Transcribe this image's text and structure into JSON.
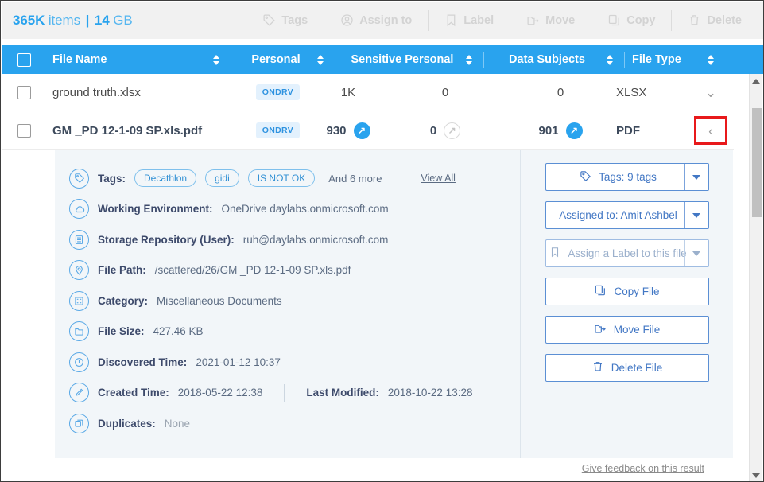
{
  "header": {
    "count": "365K",
    "count_unit": "items",
    "divider": "|",
    "size": "14",
    "size_unit": "GB",
    "toolbar": [
      {
        "label": "Tags",
        "icon": "tag-icon",
        "enabled": false
      },
      {
        "label": "Assign to",
        "icon": "user-circle-icon",
        "enabled": false
      },
      {
        "label": "Label",
        "icon": "bookmark-icon",
        "enabled": false
      },
      {
        "label": "Move",
        "icon": "move-folder-icon",
        "enabled": false
      },
      {
        "label": "Copy",
        "icon": "copy-icon",
        "enabled": false
      },
      {
        "label": "Delete",
        "icon": "trash-icon",
        "enabled": false
      }
    ]
  },
  "table": {
    "columns": {
      "file_name": "File Name",
      "personal": "Personal",
      "sensitive_personal": "Sensitive Personal",
      "data_subjects": "Data Subjects",
      "file_type": "File Type"
    },
    "rows": [
      {
        "file_name": "ground truth.xlsx",
        "badge": "ONDRV",
        "personal": "1K",
        "personal_link": false,
        "sensitive_personal": "0",
        "sensitive_link": false,
        "data_subjects": "0",
        "subjects_link": false,
        "file_type": "XLSX",
        "expanded": false,
        "chevron": "⌄"
      },
      {
        "file_name": "GM _PD 12-1-09 SP.xls.pdf",
        "badge": "ONDRV",
        "personal": "930",
        "personal_link": true,
        "sensitive_personal": "0",
        "sensitive_link": false,
        "data_subjects": "901",
        "subjects_link": true,
        "file_type": "PDF",
        "expanded": true,
        "chevron": "‹"
      }
    ]
  },
  "detail": {
    "tags": {
      "label": "Tags:",
      "icon": "tag-circle-icon",
      "pills": [
        "Decathlon",
        "gidi",
        "IS NOT OK"
      ],
      "more": "And 6 more",
      "view_all": "View All"
    },
    "fields": [
      {
        "icon": "cloud-icon",
        "label": "Working Environment:",
        "value": "OneDrive daylabs.onmicrosoft.com"
      },
      {
        "icon": "database-icon",
        "label": "Storage Repository (User):",
        "value": "ruh@daylabs.onmicrosoft.com"
      },
      {
        "icon": "location-pin-icon",
        "label": "File Path:",
        "value": "/scattered/26/GM _PD 12-1-09 SP.xls.pdf"
      },
      {
        "icon": "list-icon",
        "label": "Category:",
        "value": "Miscellaneous Documents"
      },
      {
        "icon": "folder-icon",
        "label": "File Size:",
        "value": "427.46 KB"
      },
      {
        "icon": "clock-icon",
        "label": "Discovered Time:",
        "value": "2021-01-12 10:37"
      }
    ],
    "created": {
      "icon": "pencil-icon",
      "label": "Created Time:",
      "value": "2018-05-22 12:38",
      "modified_label": "Last Modified:",
      "modified_value": "2018-10-22 13:28"
    },
    "duplicates": {
      "icon": "duplicate-icon",
      "label": "Duplicates:",
      "value": "None"
    },
    "actions": [
      {
        "label": "Tags: 9 tags",
        "icon": "tag-circle-icon",
        "caret": true,
        "muted": false
      },
      {
        "label": "Assigned to: Amit Ashbel",
        "icon": "",
        "caret": true,
        "muted": false
      },
      {
        "label": "Assign a Label to this file",
        "icon": "bookmark-icon",
        "caret": true,
        "muted": true
      },
      {
        "label": "Copy File",
        "icon": "copy-icon",
        "caret": false,
        "muted": false
      },
      {
        "label": "Move File",
        "icon": "move-folder-icon",
        "caret": false,
        "muted": false
      },
      {
        "label": "Delete File",
        "icon": "trash-icon",
        "caret": false,
        "muted": false
      }
    ]
  },
  "footer": {
    "feedback": "Give feedback on this result"
  },
  "colors": {
    "accent_blue": "#29a3ee",
    "header_bg": "#f1f1f1",
    "detail_bg": "#f2f6f9",
    "button_blue": "#4277c4",
    "highlight_red": "#e8191b",
    "badge_bg": "#e3f1fd"
  }
}
